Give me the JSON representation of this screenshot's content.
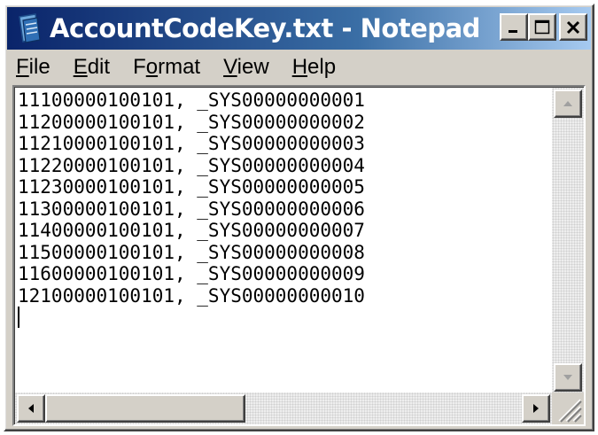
{
  "window": {
    "title": "AccountCodeKey.txt - Notepad",
    "icon": "notepad-icon"
  },
  "title_buttons": {
    "minimize": "minimize-icon",
    "maximize": "maximize-icon",
    "close": "close-icon"
  },
  "menu": {
    "items": [
      {
        "accel": "F",
        "rest": "ile"
      },
      {
        "accel": "E",
        "rest": "dit"
      },
      {
        "pre": "F",
        "accel": "o",
        "rest": "rmat"
      },
      {
        "accel": "V",
        "rest": "iew"
      },
      {
        "accel": "H",
        "rest": "elp"
      }
    ]
  },
  "editor": {
    "lines": [
      "11100000100101, _SYS00000000001",
      "11200000100101, _SYS00000000002",
      "11210000100101, _SYS00000000003",
      "11220000100101, _SYS00000000004",
      "11230000100101, _SYS00000000005",
      "11300000100101, _SYS00000000006",
      "11400000100101, _SYS00000000007",
      "11500000100101, _SYS00000000008",
      "11600000100101, _SYS00000000009",
      "12100000100101, _SYS00000000010"
    ]
  },
  "colors": {
    "title_active": "#0a246a",
    "face": "#d4d0c8"
  }
}
